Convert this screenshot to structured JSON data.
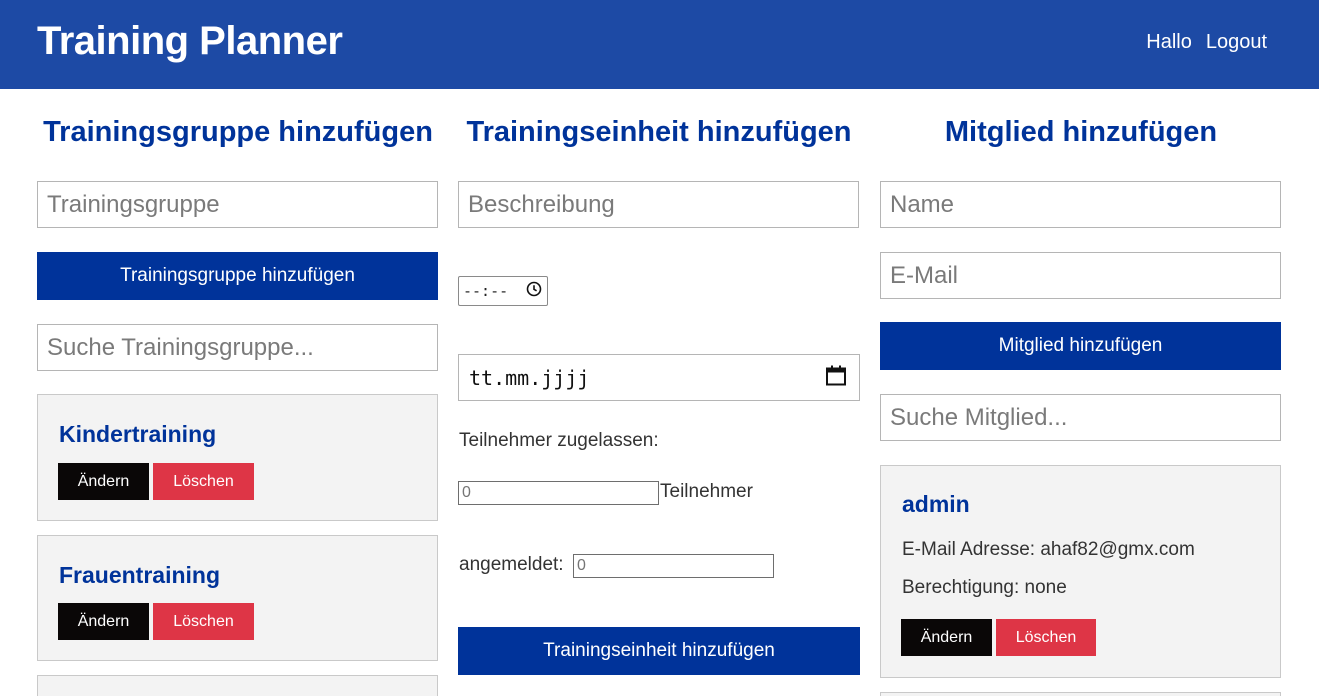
{
  "header": {
    "title": "Training Planner",
    "nav": [
      "Hallo",
      "Logout"
    ],
    "background": "#1d4aa5"
  },
  "groups": {
    "heading": "Trainingsgruppe hinzufügen",
    "name_placeholder": "Trainingsgruppe",
    "add_button": "Trainingsgruppe hinzufügen",
    "search_placeholder": "Suche Trainingsgruppe...",
    "items": [
      {
        "name": "Kindertraining",
        "edit": "Ändern",
        "delete": "Löschen"
      },
      {
        "name": "Frauentraining",
        "edit": "Ändern",
        "delete": "Löschen"
      }
    ]
  },
  "sessions": {
    "heading": "Trainingseinheit hinzufügen",
    "description_placeholder": "Beschreibung",
    "time_placeholder": "--:--",
    "date_placeholder": "tt.mm.jjjj",
    "allowed_label": "Teilnehmer zugelassen:",
    "allowed_value": "0",
    "participants_suffix": "Teilnehmer",
    "registered_label": "angemeldet:",
    "registered_value": "0",
    "add_button": "Trainingseinheit hinzufügen"
  },
  "members": {
    "heading": "Mitglied hinzufügen",
    "name_placeholder": "Name",
    "email_placeholder": "E-Mail",
    "add_button": "Mitglied hinzufügen",
    "search_placeholder": "Suche Mitglied...",
    "items": [
      {
        "name": "admin",
        "email_line": "E-Mail Adresse: ahaf82@gmx.com",
        "permission_line": "Berechtigung: none",
        "edit": "Ändern",
        "delete": "Löschen"
      }
    ]
  },
  "colors": {
    "primary": "#00339a",
    "danger": "#de3546",
    "dark": "#0a0707",
    "card": "#f3f3f3"
  }
}
